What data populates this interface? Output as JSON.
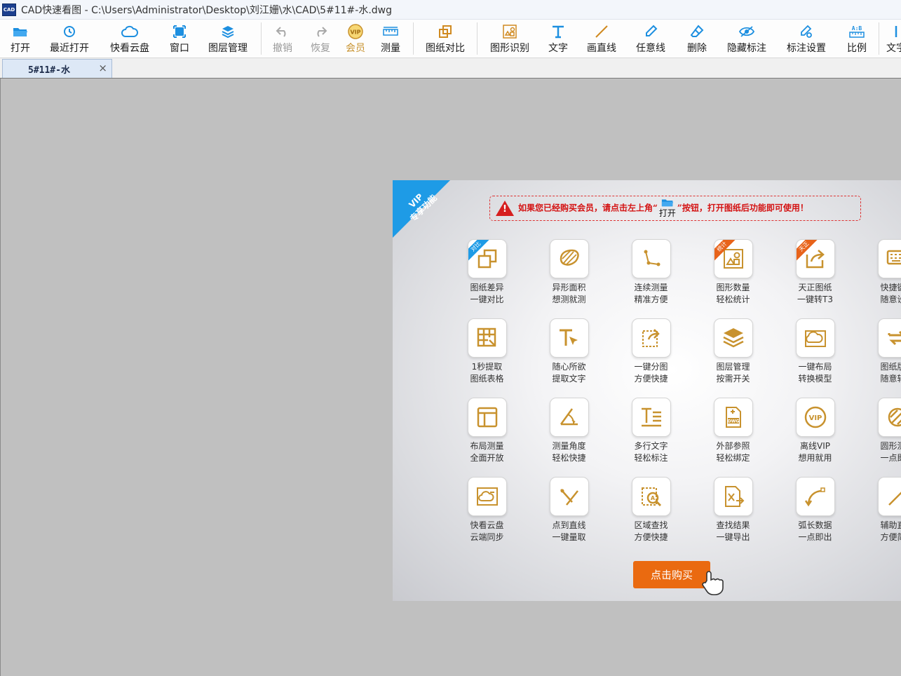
{
  "window": {
    "title": "CAD快速看图 - C:\\Users\\Administrator\\Desktop\\刘江姗\\水\\CAD\\5#11#-水.dwg",
    "logo": "CAD"
  },
  "toolbar": {
    "items": [
      {
        "label": "打开",
        "icon": "folder-open-icon"
      },
      {
        "label": "最近打开",
        "icon": "clock-icon"
      },
      {
        "label": "快看云盘",
        "icon": "cloud-icon"
      },
      {
        "label": "窗口",
        "icon": "window-icon"
      },
      {
        "label": "图层管理",
        "icon": "layers-icon"
      },
      {
        "label": "撤销",
        "icon": "undo-icon"
      },
      {
        "label": "恢复",
        "icon": "redo-icon"
      },
      {
        "label": "会员",
        "icon": "vip-icon"
      },
      {
        "label": "测量",
        "icon": "ruler-icon"
      },
      {
        "label": "图纸对比",
        "icon": "compare-icon"
      },
      {
        "label": "图形识别",
        "icon": "shape-recognize-icon"
      },
      {
        "label": "文字",
        "icon": "text-icon"
      },
      {
        "label": "画直线",
        "icon": "line-icon"
      },
      {
        "label": "任意线",
        "icon": "pen-icon"
      },
      {
        "label": "删除",
        "icon": "eraser-icon"
      },
      {
        "label": "隐藏标注",
        "icon": "eye-hide-icon"
      },
      {
        "label": "标注设置",
        "icon": "annotation-settings-icon"
      },
      {
        "label": "比例",
        "icon": "scale-icon"
      },
      {
        "label": "文字",
        "icon": "text-icon"
      }
    ]
  },
  "tabs": [
    {
      "label": "5#11#-水",
      "close": "×"
    }
  ],
  "vip": {
    "corner_text_1": "VIP",
    "corner_text_2": "专享功能",
    "notice_before": "如果您已经购买会员，请点击左上角“",
    "notice_btn": "打开",
    "notice_after": "”按钮，打开图纸后功能即可使用！",
    "buy_button": "点击购买",
    "features": [
      {
        "l1": "图纸差异",
        "l2": "一键对比",
        "icon": "compare-icon",
        "badge": "对比",
        "badge_color": "blue"
      },
      {
        "l1": "异形面积",
        "l2": "想测就测",
        "icon": "area-icon"
      },
      {
        "l1": "连续测量",
        "l2": "精准方便",
        "icon": "continuous-measure-icon"
      },
      {
        "l1": "图形数量",
        "l2": "轻松统计",
        "icon": "shape-count-icon",
        "badge": "统计",
        "badge_color": "orange"
      },
      {
        "l1": "天正图纸",
        "l2": "一键转T3",
        "icon": "export-icon",
        "badge": "天正",
        "badge_color": "orange"
      },
      {
        "l1": "快捷键位",
        "l2": "随意设置",
        "icon": "keyboard-icon"
      },
      {
        "l1": "1秒提取",
        "l2": "图纸表格",
        "icon": "table-extract-icon"
      },
      {
        "l1": "随心所欲",
        "l2": "提取文字",
        "icon": "text-extract-icon"
      },
      {
        "l1": "一键分图",
        "l2": "方便快捷",
        "icon": "split-icon"
      },
      {
        "l1": "图层管理",
        "l2": "按需开关",
        "icon": "layers-icon"
      },
      {
        "l1": "一键布局",
        "l2": "转换模型",
        "icon": "layout-icon"
      },
      {
        "l1": "图纸版本",
        "l2": "随意转换",
        "icon": "convert-icon"
      },
      {
        "l1": "布局测量",
        "l2": "全面开放",
        "icon": "layout-measure-icon"
      },
      {
        "l1": "测量角度",
        "l2": "轻松快捷",
        "icon": "angle-icon"
      },
      {
        "l1": "多行文字",
        "l2": "轻松标注",
        "icon": "multiline-text-icon"
      },
      {
        "l1": "外部参照",
        "l2": "轻松绑定",
        "icon": "xref-icon"
      },
      {
        "l1": "离线VIP",
        "l2": "想用就用",
        "icon": "vip-icon"
      },
      {
        "l1": "圆形测量",
        "l2": "一点即出",
        "icon": "circle-measure-icon"
      },
      {
        "l1": "快看云盘",
        "l2": "云端同步",
        "icon": "cloud-sync-icon"
      },
      {
        "l1": "点到直线",
        "l2": "一键量取",
        "icon": "point-line-icon"
      },
      {
        "l1": "区域查找",
        "l2": "方便快捷",
        "icon": "search-area-icon"
      },
      {
        "l1": "查找结果",
        "l2": "一键导出",
        "icon": "export-excel-icon"
      },
      {
        "l1": "弧长数据",
        "l2": "一点即出",
        "icon": "arc-icon"
      },
      {
        "l1": "辅助直线",
        "l2": "方便简单",
        "icon": "aux-line-icon"
      }
    ]
  },
  "colors": {
    "accent_blue": "#1e9be6",
    "gold": "#c8922e",
    "buy_orange": "#ea6a10",
    "warn_red": "#d41414"
  }
}
